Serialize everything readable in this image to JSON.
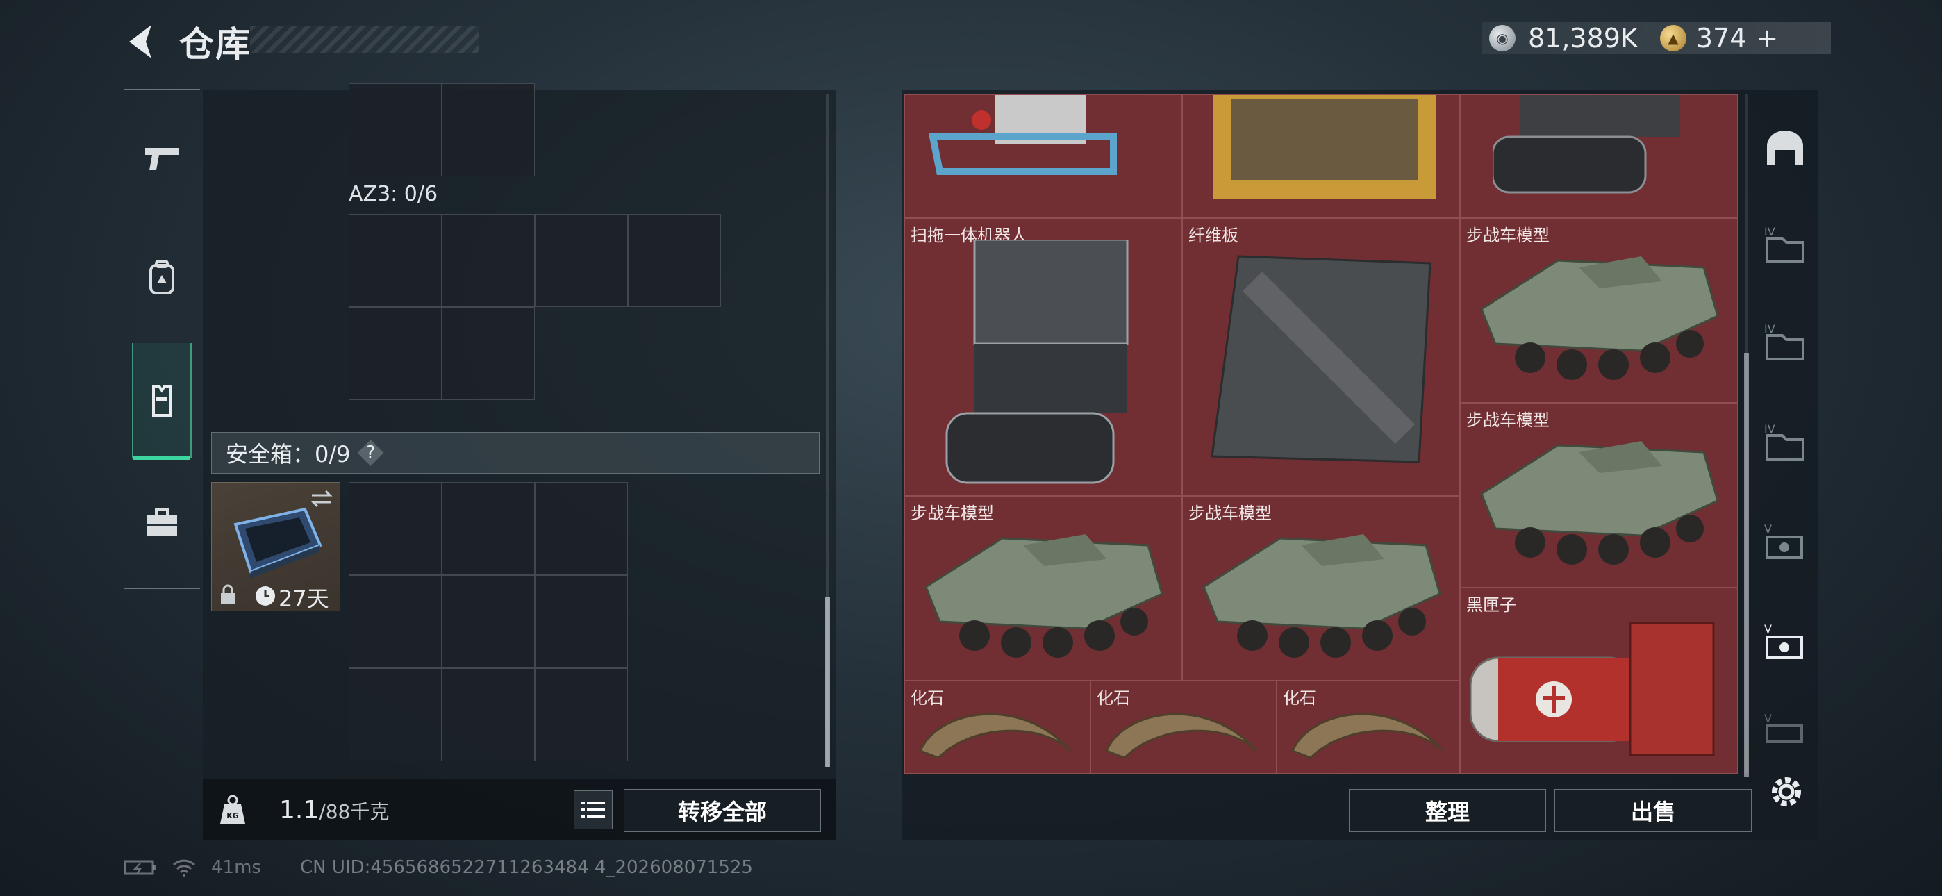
{
  "header": {
    "title": "仓库",
    "currency_primary": "81,389K",
    "currency_secondary": "374",
    "currency_add": "+"
  },
  "left_nav": {
    "items": [
      {
        "icon": "pistol-icon",
        "active": false
      },
      {
        "icon": "backpack-icon",
        "active": false
      },
      {
        "icon": "vest-icon",
        "active": true
      },
      {
        "icon": "toolbox-icon",
        "active": false
      }
    ]
  },
  "inventory": {
    "az3_label": "AZ3: 0/6",
    "safe_box_label": "安全箱：0/9",
    "safe_box_help": "?",
    "safe_box_days": "27天",
    "weight_current": "1.1",
    "weight_max": "/88千克",
    "transfer_all": "转移全部"
  },
  "stash": {
    "items": [
      {
        "name": "扫拖一体机器人"
      },
      {
        "name": "纤维板"
      },
      {
        "name": "步战车模型"
      },
      {
        "name": "步战车模型"
      },
      {
        "name": "步战车模型"
      },
      {
        "name": "步战车模型"
      },
      {
        "name": "黑匣子"
      },
      {
        "name": "化石"
      },
      {
        "name": "化石"
      },
      {
        "name": "化石"
      }
    ],
    "sort_label": "整理",
    "sell_label": "出售"
  },
  "right_tabs": {
    "tab_badges": [
      "IV",
      "IV",
      "IV",
      "V",
      "V",
      "V"
    ]
  },
  "status_bar": {
    "ping": "41ms",
    "uid": "CN UID:4565686522711263484 4_202608071525"
  },
  "colors": {
    "accent_green": "#3dd6a0",
    "stash_red": "#6d2c30"
  }
}
